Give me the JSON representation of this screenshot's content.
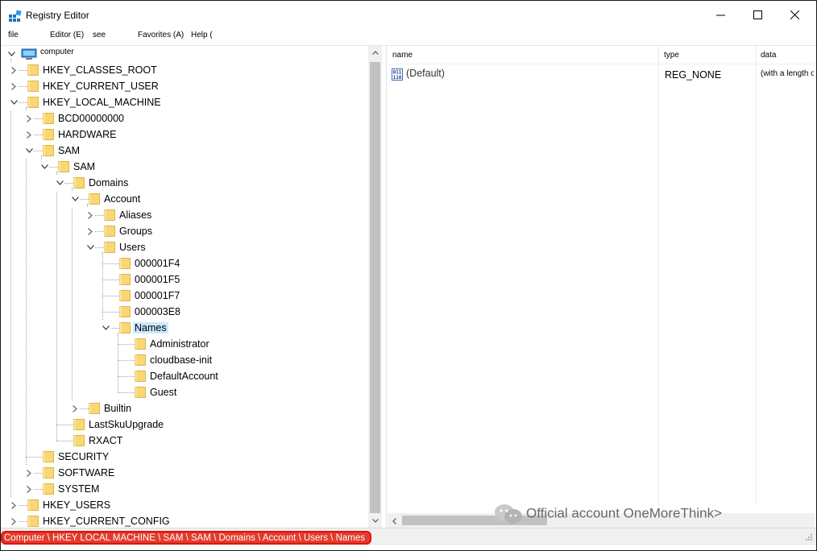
{
  "window": {
    "title": "Registry Editor",
    "minimize_glyph": "—",
    "maximize_glyph": "☐",
    "close_glyph": "✕"
  },
  "menu": [
    {
      "label": "file"
    },
    {
      "label": "Editor (E)"
    },
    {
      "label": "see"
    },
    {
      "label": "Favorites (A)"
    },
    {
      "label": "Help ("
    }
  ],
  "tree": {
    "root": "computer",
    "nodes": [
      {
        "label": "HKEY_CLASSES_ROOT",
        "level": 1,
        "expander": "collapsed"
      },
      {
        "label": "HKEY_CURRENT_USER",
        "level": 1,
        "expander": "collapsed"
      },
      {
        "label": "HKEY_LOCAL_MACHINE",
        "level": 1,
        "expander": "expanded"
      },
      {
        "label": "BCD00000000",
        "level": 2,
        "expander": "collapsed"
      },
      {
        "label": "HARDWARE",
        "level": 2,
        "expander": "collapsed"
      },
      {
        "label": "SAM",
        "level": 2,
        "expander": "expanded"
      },
      {
        "label": "SAM",
        "level": 3,
        "expander": "expanded"
      },
      {
        "label": "Domains",
        "level": 4,
        "expander": "expanded"
      },
      {
        "label": "Account",
        "level": 5,
        "expander": "expanded"
      },
      {
        "label": "Aliases",
        "level": 6,
        "expander": "collapsed"
      },
      {
        "label": "Groups",
        "level": 6,
        "expander": "collapsed"
      },
      {
        "label": "Users",
        "level": 6,
        "expander": "expanded"
      },
      {
        "label": "000001F4",
        "level": 7,
        "expander": "none"
      },
      {
        "label": "000001F5",
        "level": 7,
        "expander": "none"
      },
      {
        "label": "000001F7",
        "level": 7,
        "expander": "none"
      },
      {
        "label": "000003E8",
        "level": 7,
        "expander": "none"
      },
      {
        "label": "Names",
        "level": 7,
        "expander": "expanded",
        "selected": true
      },
      {
        "label": "Administrator",
        "level": 8,
        "expander": "none"
      },
      {
        "label": "cloudbase-init",
        "level": 8,
        "expander": "none"
      },
      {
        "label": "DefaultAccount",
        "level": 8,
        "expander": "none"
      },
      {
        "label": "Guest",
        "level": 8,
        "expander": "none"
      },
      {
        "label": "Builtin",
        "level": 5,
        "expander": "collapsed"
      },
      {
        "label": "LastSkuUpgrade",
        "level": 4,
        "expander": "none"
      },
      {
        "label": "RXACT",
        "level": 4,
        "expander": "none"
      },
      {
        "label": "SECURITY",
        "level": 2,
        "expander": "none"
      },
      {
        "label": "SOFTWARE",
        "level": 2,
        "expander": "collapsed"
      },
      {
        "label": "SYSTEM",
        "level": 2,
        "expander": "collapsed"
      },
      {
        "label": "HKEY_USERS",
        "level": 1,
        "expander": "collapsed"
      },
      {
        "label": "HKEY_CURRENT_CONFIG",
        "level": 1,
        "expander": "collapsed"
      }
    ]
  },
  "list": {
    "columns": [
      "name",
      "type",
      "data"
    ],
    "rows": [
      {
        "name": "(Default)",
        "type": "REG_NONE",
        "data": "(with a length of"
      }
    ],
    "value_icon_text": "011\n110"
  },
  "watermark": "Official account OneMoreThink>",
  "status": {
    "path": "Computer \\ HKEY LOCAL MACHINE \\ SAM \\ SAM \\ Domains \\ Account \\ Users \\ Names"
  },
  "colors": {
    "selection": "#cce8ff",
    "folder": "#f8d775",
    "folder_edge": "#d9a72b",
    "status_highlight": "#e23b2c"
  }
}
